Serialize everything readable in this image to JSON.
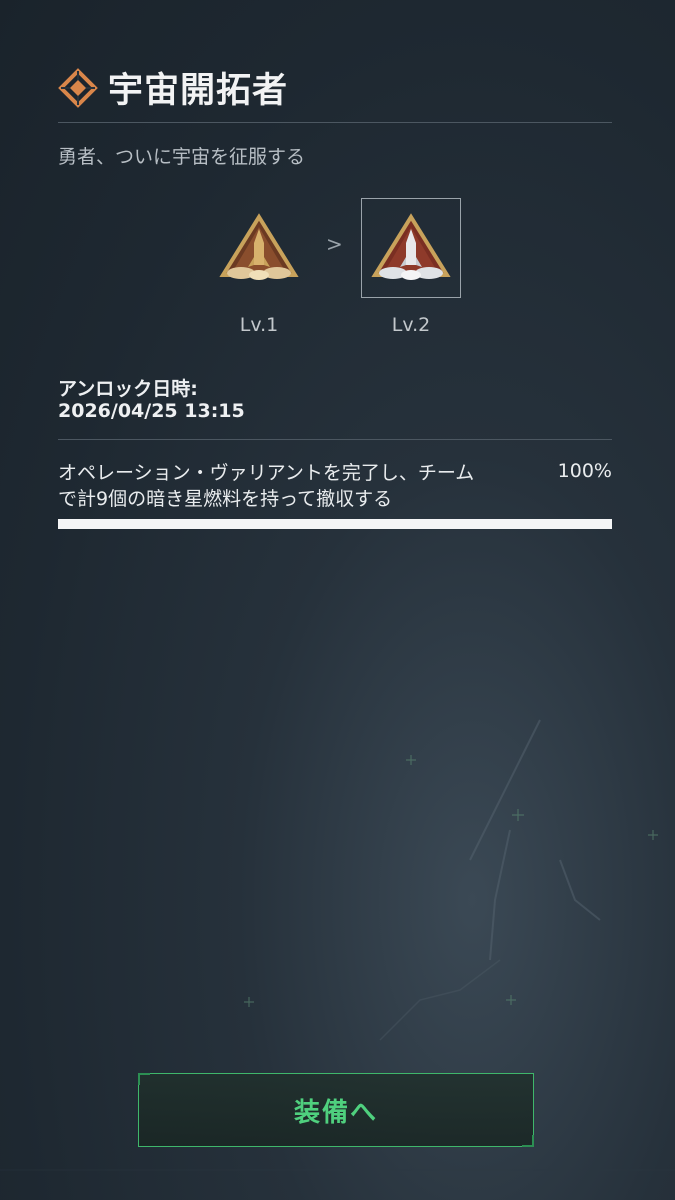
{
  "header": {
    "title": "宇宙開拓者",
    "icon": "diamond-emblem-icon",
    "subtitle": "勇者、ついに宇宙を征服する"
  },
  "badges": [
    {
      "level_label": "Lv.1",
      "icon": "rocket-triangle-badge-icon",
      "selected": false
    },
    {
      "level_label": "Lv.2",
      "icon": "rocket-triangle-badge-icon",
      "selected": true
    }
  ],
  "arrow": ">",
  "unlock": {
    "label": "アンロック日時:",
    "date": "2026/04/25 13:15"
  },
  "task": {
    "line1": "オペレーション・ヴァリアントを完了し、チーム",
    "line2": "で計9個の暗き星燃料を持って撤収する",
    "percent_text": "100%",
    "progress": 1.0
  },
  "button": {
    "label": "装備へ"
  },
  "colors": {
    "accent_orange": "#d9864a",
    "button_green": "#4fd07e",
    "button_border": "#3fb76b"
  }
}
